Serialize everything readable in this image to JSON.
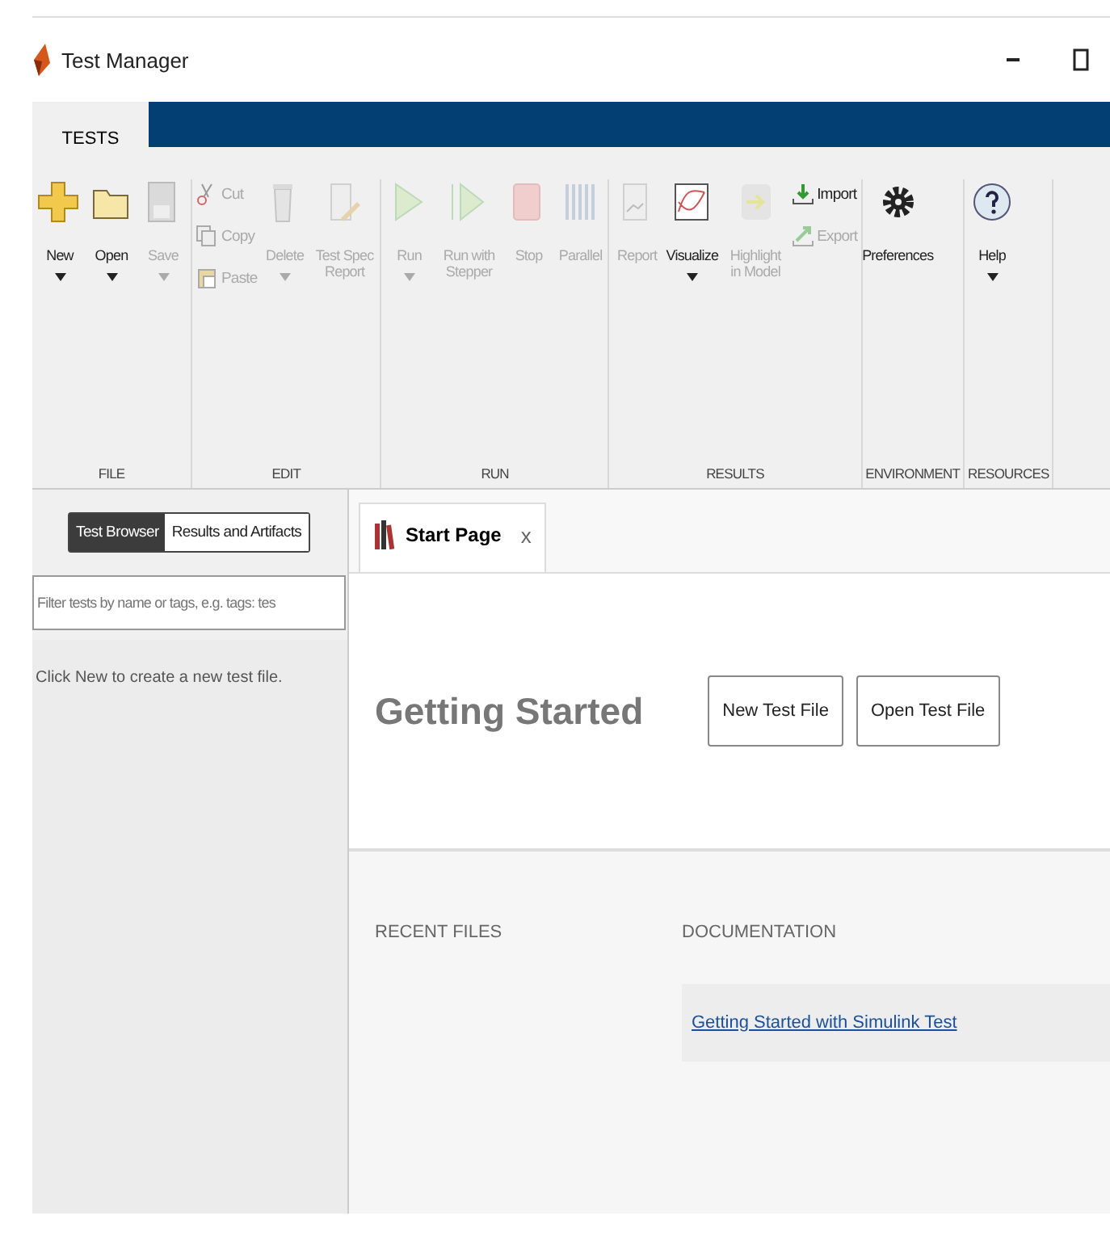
{
  "window": {
    "title": "Test Manager"
  },
  "toolstrip_tabs": [
    {
      "label": "TESTS",
      "selected": true
    }
  ],
  "ribbon": [
    {
      "label": "FILE",
      "items": [
        {
          "kind": "large",
          "label": "New",
          "disabled": false,
          "dropdown": true
        },
        {
          "kind": "large",
          "label": "Open",
          "disabled": false,
          "dropdown": true
        },
        {
          "kind": "large",
          "label": "Save",
          "disabled": true,
          "dropdown": true
        }
      ]
    },
    {
      "label": "EDIT",
      "items": [
        {
          "kind": "stack",
          "buttons": [
            {
              "label": "Cut",
              "disabled": true
            },
            {
              "label": "Copy",
              "disabled": true
            },
            {
              "label": "Paste",
              "disabled": true
            }
          ]
        },
        {
          "kind": "large",
          "label": "Delete",
          "disabled": true,
          "dropdown": true
        },
        {
          "kind": "large",
          "label": "Test Spec Report",
          "disabled": true,
          "dropdown": false
        }
      ]
    },
    {
      "label": "RUN",
      "items": [
        {
          "kind": "large",
          "label": "Run",
          "disabled": true,
          "dropdown": true
        },
        {
          "kind": "large",
          "label": "Run with Stepper",
          "disabled": true,
          "dropdown": false
        },
        {
          "kind": "large",
          "label": "Stop",
          "disabled": true,
          "dropdown": false
        },
        {
          "kind": "large",
          "label": "Parallel",
          "disabled": true,
          "dropdown": false
        }
      ]
    },
    {
      "label": "RESULTS",
      "items": [
        {
          "kind": "large",
          "label": "Report",
          "disabled": true,
          "dropdown": false
        },
        {
          "kind": "large",
          "label": "Visualize",
          "disabled": false,
          "dropdown": true
        },
        {
          "kind": "large",
          "label": "Highlight in Model",
          "disabled": true,
          "dropdown": false
        },
        {
          "kind": "stack",
          "buttons": [
            {
              "label": "Import",
              "disabled": false
            },
            {
              "label": "Export",
              "disabled": true
            }
          ]
        }
      ]
    },
    {
      "label": "ENVIRONMENT",
      "items": [
        {
          "kind": "large",
          "label": "Preferences",
          "disabled": false,
          "dropdown": false
        }
      ]
    },
    {
      "label": "RESOURCES",
      "items": [
        {
          "kind": "large",
          "label": "Help",
          "disabled": false,
          "dropdown": true
        }
      ]
    }
  ],
  "left_panel": {
    "tabs": [
      {
        "label": "Test Browser",
        "selected": true
      },
      {
        "label": "Results and Artifacts",
        "selected": false
      }
    ],
    "filter": {
      "placeholder": "Filter tests by name or tags, e.g. tags: tes"
    },
    "message": "Click New to create a new test file."
  },
  "document_tabs": [
    {
      "label": "Start Page",
      "close": "x",
      "selected": true
    }
  ],
  "start_page": {
    "heading": "Getting Started",
    "buttons": [
      "New Test File",
      "Open Test File"
    ],
    "recent_files": {
      "heading": "RECENT FILES"
    },
    "documentation": {
      "heading": "DOCUMENTATION",
      "links": [
        "Getting Started with Simulink Test"
      ]
    }
  }
}
